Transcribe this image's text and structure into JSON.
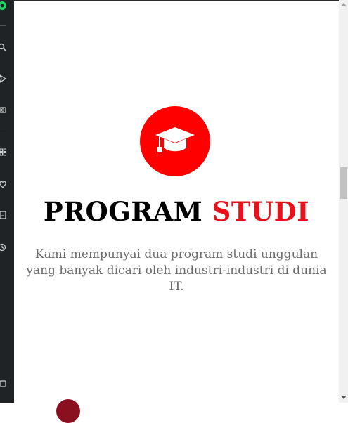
{
  "sidebar": {
    "icons": [
      "whatsapp-icon",
      "search-icon",
      "send-icon",
      "camera-icon",
      "apps-icon",
      "heart-icon",
      "news-icon",
      "history-icon",
      "window-icon"
    ]
  },
  "hero": {
    "icon": "graduation-cap-icon",
    "icon_bg": "#ff0000",
    "title_part1": "PROGRAM",
    "title_part2": "STUDI",
    "title_part2_color": "#e8111a",
    "description": "Kami mempunyai dua program studi unggulan yang banyak dicari oleh industri-industri di dunia IT."
  }
}
